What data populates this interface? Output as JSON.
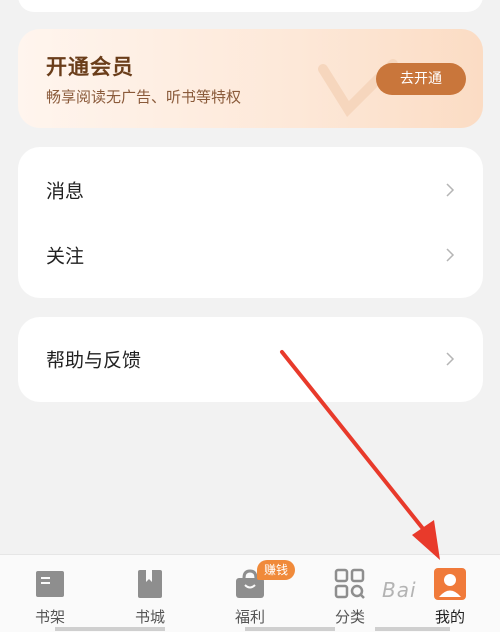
{
  "vip": {
    "title": "开通会员",
    "subtitle": "畅享阅读无广告、听书等特权",
    "button": "去开通"
  },
  "menu": {
    "messages": "消息",
    "follow": "关注",
    "help": "帮助与反馈"
  },
  "nav": {
    "tabs": [
      {
        "label": "书架",
        "icon": "bookshelf-icon"
      },
      {
        "label": "书城",
        "icon": "bookstore-icon"
      },
      {
        "label": "福利",
        "icon": "gift-bag-icon"
      },
      {
        "label": "分类",
        "icon": "category-grid-icon"
      },
      {
        "label": "我的",
        "icon": "profile-icon"
      }
    ],
    "badge": "赚钱",
    "active_color": "#f07a3a"
  },
  "watermark": "Bai"
}
